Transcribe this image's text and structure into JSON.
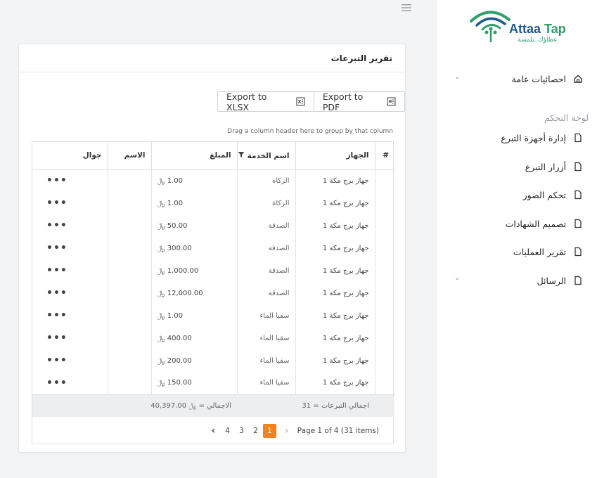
{
  "brand": {
    "name_part1": "Attaa",
    "name_part2": "Tap",
    "tagline": "عطاؤك..بلمسة",
    "colors": {
      "primary": "#1e5a8e",
      "green": "#2f9e6a",
      "accent": "#f58220"
    }
  },
  "sidebar": {
    "items": [
      {
        "label": "احصائيات عامة",
        "icon": "home-icon",
        "has_chevron": true
      },
      {
        "label": "إدارة أجهزة التبرع",
        "icon": "document-icon"
      },
      {
        "label": "أزرار التبرع",
        "icon": "document-icon"
      },
      {
        "label": "تحكم الصور",
        "icon": "document-icon"
      },
      {
        "label": "تصميم الشهادات",
        "icon": "document-icon"
      },
      {
        "label": "تقرير العمليات",
        "icon": "document-icon"
      },
      {
        "label": "الرسائل",
        "icon": "document-icon",
        "has_chevron": true
      }
    ],
    "section_label": "لوحة التحكم"
  },
  "card": {
    "title": "تقرير التبرعات",
    "export_xlsx": "Export to XLSX",
    "export_pdf": "Export to PDF",
    "drag_hint": "Drag a column header here to group by that column"
  },
  "table": {
    "columns": [
      "#",
      "الجهاز",
      "اسم الخدمة",
      "المبلغ",
      "الاسم",
      "جوال"
    ],
    "rows": [
      {
        "device": "جهاز برج مكة 1",
        "service": "الزكاة",
        "amount": "1.00 ﷼",
        "name": "",
        "mobile": "•••"
      },
      {
        "device": "جهاز برج مكة 1",
        "service": "الزكاة",
        "amount": "1.00 ﷼",
        "name": "",
        "mobile": "•••"
      },
      {
        "device": "جهاز برج مكة 1",
        "service": "الصدقة",
        "amount": "50.00 ﷼",
        "name": "",
        "mobile": "•••"
      },
      {
        "device": "جهاز برج مكة 1",
        "service": "الصدقة",
        "amount": "300.00 ﷼",
        "name": "",
        "mobile": "•••"
      },
      {
        "device": "جهاز برج مكة 1",
        "service": "الصدقة",
        "amount": "1,000.00 ﷼",
        "name": "",
        "mobile": "•••"
      },
      {
        "device": "جهاز برج مكة 1",
        "service": "الصدقة",
        "amount": "12,000.00 ﷼",
        "name": "",
        "mobile": "•••"
      },
      {
        "device": "جهاز برج مكة 1",
        "service": "سقيا الماء",
        "amount": "1.00 ﷼",
        "name": "",
        "mobile": "•••"
      },
      {
        "device": "جهاز برج مكة 1",
        "service": "سقيا الماء",
        "amount": "400.00 ﷼",
        "name": "",
        "mobile": "•••"
      },
      {
        "device": "جهاز برج مكة 1",
        "service": "سقيا الماء",
        "amount": "200.00 ﷼",
        "name": "",
        "mobile": "•••"
      },
      {
        "device": "جهاز برج مكة 1",
        "service": "سقيا الماء",
        "amount": "150.00 ﷼",
        "name": "",
        "mobile": "•••"
      }
    ],
    "footer": {
      "count": "اجمالي التبرعات = 31",
      "total": "الاجمالي = ﷼ 40,397.00"
    }
  },
  "pager": {
    "pages": [
      "1",
      "2",
      "3",
      "4"
    ],
    "current": "1",
    "info": "Page 1 of 4 (31 items)"
  }
}
